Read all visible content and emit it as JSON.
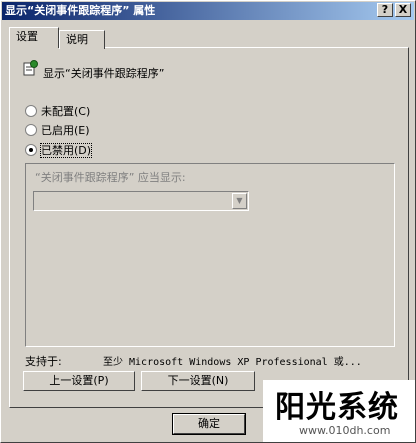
{
  "window": {
    "title": "显示“关闭事件跟踪程序” 属性",
    "help_glyph": "?",
    "close_glyph": "X"
  },
  "tabs": [
    {
      "label": "设置",
      "active": true
    },
    {
      "label": "说明",
      "active": false
    }
  ],
  "policy": {
    "title": "显示“关闭事件跟踪程序”",
    "icon": "policy-document-icon"
  },
  "options": [
    {
      "label": "未配置(C)",
      "checked": false
    },
    {
      "label": "已启用(E)",
      "checked": false
    },
    {
      "label": "已禁用(D)",
      "checked": true
    }
  ],
  "setting": {
    "label": "“关闭事件跟踪程序” 应当显示:",
    "value": ""
  },
  "support": {
    "label": "支持于:",
    "value": "至少 Microsoft Windows XP Professional 或..."
  },
  "buttons": {
    "prev": "上一设置(P)",
    "next": "下一设置(N)",
    "ok": "确定"
  },
  "watermark": {
    "text": "阳光系统",
    "url": "www.010dh.com"
  }
}
